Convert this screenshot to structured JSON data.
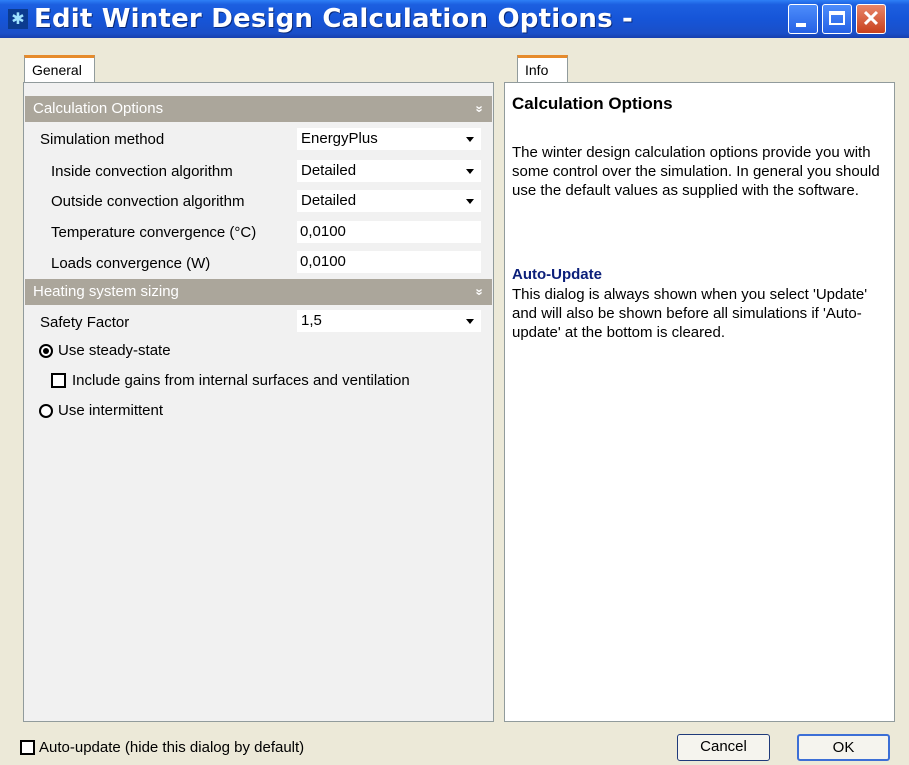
{
  "window": {
    "title": "Edit Winter Design Calculation Options -",
    "icon": "app-icon",
    "controls": [
      "minimize",
      "maximize",
      "close"
    ]
  },
  "tabs": {
    "general": "General",
    "info": "Info"
  },
  "calculation_options": {
    "header": "Calculation Options",
    "collapse_glyph": "»",
    "simulation_method": {
      "label": "Simulation method",
      "value": "EnergyPlus"
    },
    "inside_convection": {
      "label": "Inside convection algorithm",
      "value": "Detailed"
    },
    "outside_convection": {
      "label": "Outside convection algorithm",
      "value": "Detailed"
    },
    "temperature_convergence": {
      "label": "Temperature convergence (°C)",
      "value": "0,0100"
    },
    "loads_convergence": {
      "label": "Loads convergence (W)",
      "value": "0,0100"
    }
  },
  "heating_sizing": {
    "header": "Heating system sizing",
    "collapse_glyph": "»",
    "safety_factor": {
      "label": "Safety Factor",
      "value": "1,5"
    },
    "steady_state": {
      "label": "Use steady-state",
      "checked": true
    },
    "include_gains": {
      "label": "Include gains from internal surfaces and ventilation",
      "checked": false
    },
    "intermittent": {
      "label": "Use intermittent",
      "checked": false
    }
  },
  "info": {
    "title": "Calculation Options",
    "paragraph1": "The winter design calculation options provide you with some control over the simulation.  In general you should use the default values as supplied with the software.",
    "subtitle": "Auto-Update",
    "paragraph2": "This dialog is always shown when you select 'Update' and will also be shown before all simulations if 'Auto-update' at the bottom is cleared."
  },
  "footer": {
    "auto_update_label": "Auto-update (hide this dialog by default)",
    "auto_update_checked": false,
    "cancel_label": "Cancel",
    "ok_label": "OK"
  }
}
